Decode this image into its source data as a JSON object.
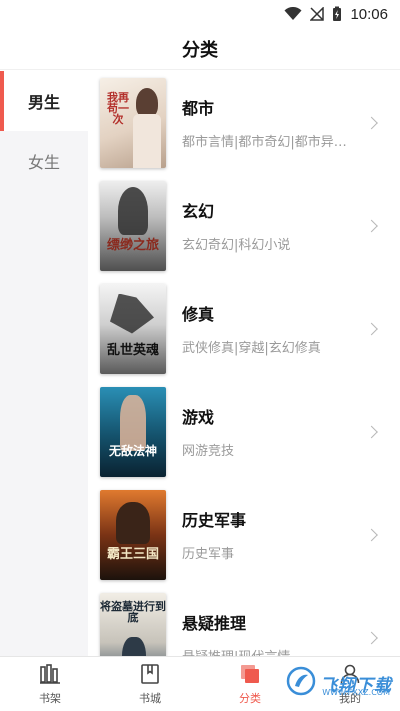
{
  "status": {
    "time": "10:06"
  },
  "page": {
    "title": "分类"
  },
  "sidebar": {
    "items": [
      {
        "label": "男生",
        "active": true
      },
      {
        "label": "女生",
        "active": false
      }
    ]
  },
  "categories": [
    {
      "name": "都市",
      "sub": "都市言情|都市奇幻|都市异能|...",
      "cover_text": "我再苟一次",
      "cover_colors": [
        "#f3ece3",
        "#c9b7a8"
      ]
    },
    {
      "name": "玄幻",
      "sub": "玄幻奇幻|科幻小说",
      "cover_text": "缥缈之旅",
      "cover_colors": [
        "#d9d9d9",
        "#5f5f5f"
      ]
    },
    {
      "name": "修真",
      "sub": "武侠修真|穿越|玄幻修真",
      "cover_text": "乱世英魂",
      "cover_colors": [
        "#e8e8e8",
        "#4a4a4a"
      ]
    },
    {
      "name": "游戏",
      "sub": "网游竞技",
      "cover_text": "无敌法神",
      "cover_colors": [
        "#1b6b8f",
        "#0b2c3d"
      ]
    },
    {
      "name": "历史军事",
      "sub": "历史军事",
      "cover_text": "霸王三国",
      "cover_colors": [
        "#b8541c",
        "#2a1a12"
      ]
    },
    {
      "name": "悬疑推理",
      "sub": "悬疑推理|现代言情",
      "cover_text": "将盗墓进行到底",
      "cover_colors": [
        "#e9e4da",
        "#39495a"
      ]
    }
  ],
  "bottomnav": {
    "items": [
      {
        "label": "书架",
        "icon": "bookshelf-icon",
        "active": false
      },
      {
        "label": "书城",
        "icon": "bookstore-icon",
        "active": false
      },
      {
        "label": "分类",
        "icon": "category-icon",
        "active": true
      },
      {
        "label": "我的",
        "icon": "profile-icon",
        "active": false
      }
    ]
  },
  "watermark": {
    "text": "飞翔下载",
    "sub": "WWW.FXXZ.COM"
  },
  "colors": {
    "accent": "#ef5a4e",
    "sidebar_bg": "#f5f5f7",
    "muted_text": "#9a9a9a"
  }
}
